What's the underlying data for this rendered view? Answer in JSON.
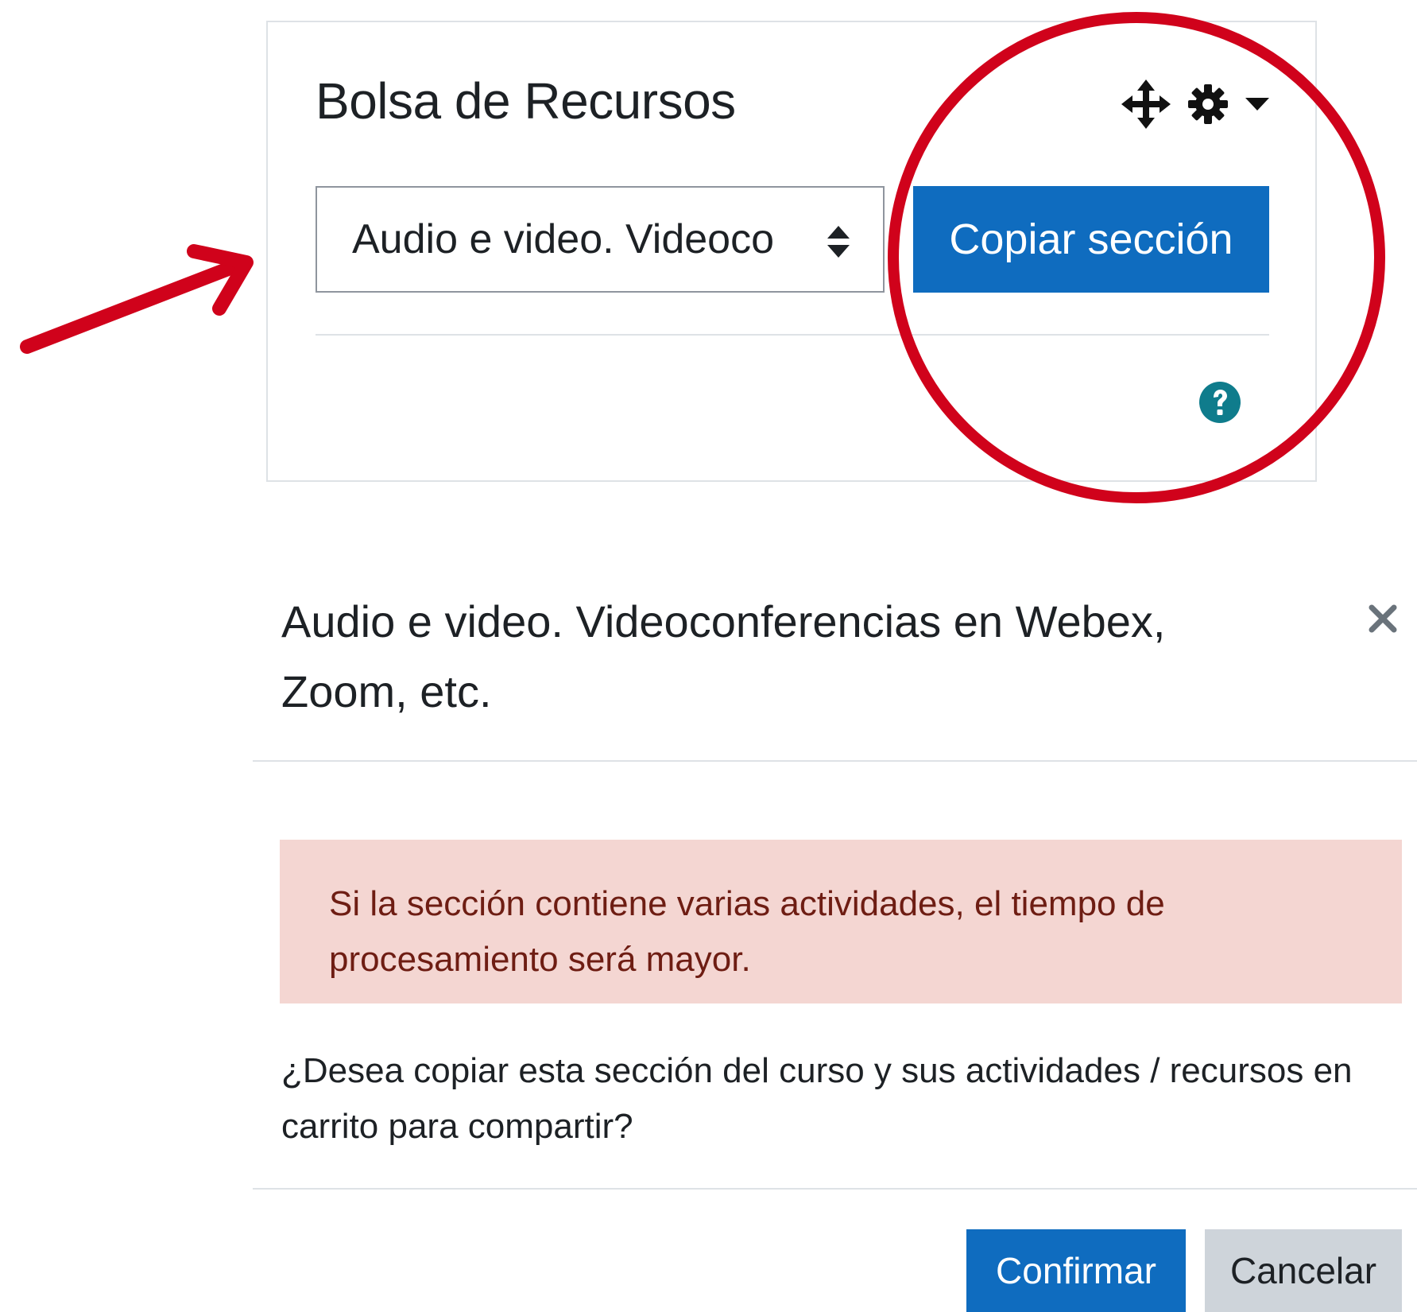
{
  "block": {
    "title": "Bolsa de Recursos",
    "controls": {
      "move_icon": "move-icon",
      "settings_icon": "gear-icon",
      "menu_icon": "caret-down-icon"
    },
    "section_select": {
      "selected_value": "Audio e video. Videoco"
    },
    "copy_button_label": "Copiar sección",
    "help_icon": "question-circle-icon"
  },
  "modal": {
    "title": "Audio e video. Videoconferencias en Webex, Zoom, etc.",
    "close_icon": "close-icon",
    "alert_text": "Si la sección contiene varias actividades, el tiempo de procesamiento será mayor.",
    "question_text": "¿Desea copiar esta sección del curso y sus actividades / recursos en carrito para compartir?",
    "confirm_label": "Confirmar",
    "cancel_label": "Cancelar"
  },
  "colors": {
    "primary": "#0f6cbf",
    "alert_background": "#f4d6d2",
    "alert_text": "#6e1d13",
    "secondary_button": "#ced4da",
    "annotation_red": "#d0021b",
    "help_icon": "#0f7c8c"
  }
}
